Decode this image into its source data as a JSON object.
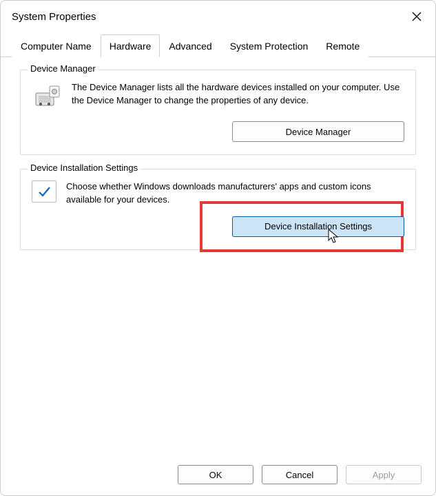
{
  "window": {
    "title": "System Properties"
  },
  "tabs": [
    {
      "label": "Computer Name"
    },
    {
      "label": "Hardware",
      "active": true
    },
    {
      "label": "Advanced"
    },
    {
      "label": "System Protection"
    },
    {
      "label": "Remote"
    }
  ],
  "group1": {
    "title": "Device Manager",
    "desc": "The Device Manager lists all the hardware devices installed on your computer. Use the Device Manager to change the properties of any device.",
    "button": "Device Manager"
  },
  "group2": {
    "title": "Device Installation Settings",
    "desc": "Choose whether Windows downloads manufacturers' apps and custom icons available for your devices.",
    "button": "Device Installation Settings"
  },
  "footer": {
    "ok": "OK",
    "cancel": "Cancel",
    "apply": "Apply"
  }
}
